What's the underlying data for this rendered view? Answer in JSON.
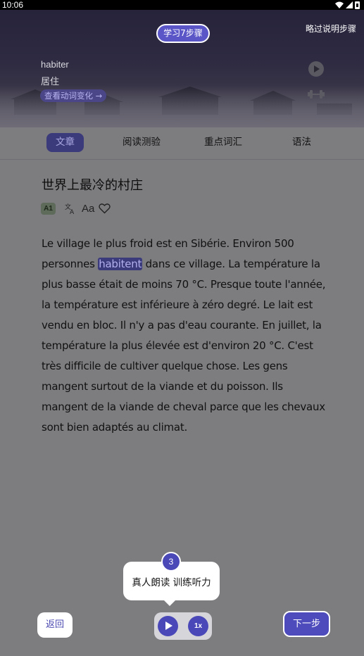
{
  "status_bar": {
    "time": "10:06"
  },
  "hero": {
    "step_badge": "学习7步骤",
    "skip_label": "略过说明步骤",
    "word": "habiter",
    "meaning": "居住",
    "conjugation_link": "查看动词变化 →"
  },
  "tabs": [
    {
      "label": "文章",
      "active": true
    },
    {
      "label": "阅读测验",
      "active": false
    },
    {
      "label": "重点词汇",
      "active": false
    },
    {
      "label": "语法",
      "active": false
    }
  ],
  "article": {
    "title": "世界上最冷的村庄",
    "level": "A1",
    "font_size_label": "Aa",
    "text_before": "Le village le plus froid est en Sibérie. Environ 500 personnes ",
    "highlight": "habitent",
    "text_after": " dans ce village. La température la plus basse était de moins 70 °C. Presque toute l'année, la température est inférieure à zéro degré. Le lait est vendu en bloc. Il n'y a pas d'eau courante. En juillet, la température la plus élevée est d'environ 20 °C. C'est très difficile de cultiver quelque chose. Les gens mangent surtout de la viande et du poisson. Ils mangent de la viande de cheval parce que les chevaux sont bien adaptés au climat."
  },
  "guide": {
    "step_number": "3",
    "tooltip": "真人朗读 训练听力"
  },
  "bottom_bar": {
    "back_label": "返回",
    "speed_label": "1x",
    "next_label": "下一步"
  },
  "colors": {
    "accent": "#4e4bbd",
    "overlay": "#7d7d80"
  }
}
